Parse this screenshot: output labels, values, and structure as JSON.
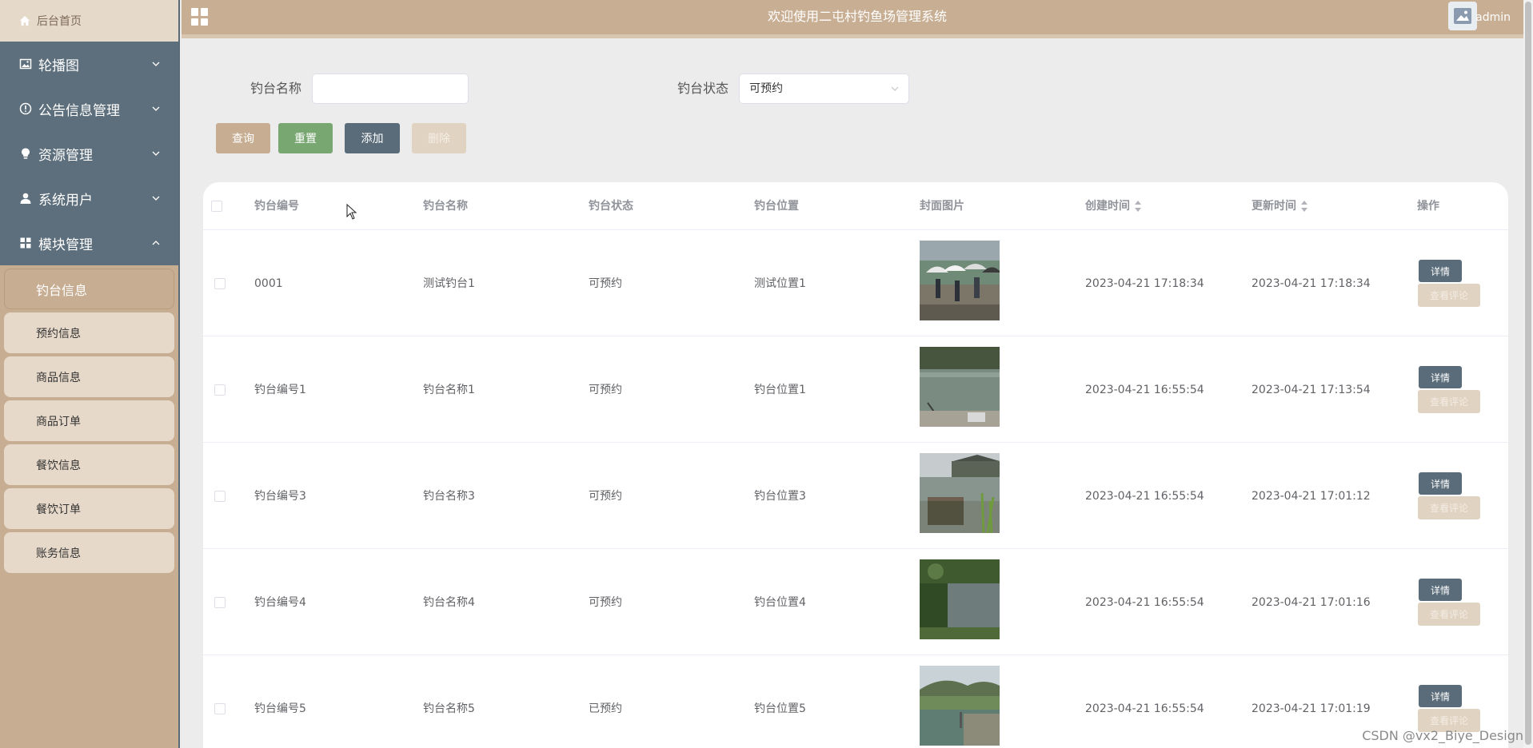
{
  "sidebar": {
    "home_label": "后台首页",
    "menus": [
      {
        "label": "轮播图",
        "icon": "picture-icon"
      },
      {
        "label": "公告信息管理",
        "icon": "info-circle-icon"
      },
      {
        "label": "资源管理",
        "icon": "lightbulb-icon"
      },
      {
        "label": "系统用户",
        "icon": "user-icon"
      },
      {
        "label": "模块管理",
        "icon": "grid-icon"
      }
    ],
    "submenu": [
      "钓台信息",
      "预约信息",
      "商品信息",
      "商品订单",
      "餐饮信息",
      "餐饮订单",
      "账务信息"
    ]
  },
  "header": {
    "title": "欢迎使用二屯村钓鱼场管理系统",
    "user": "admin"
  },
  "search": {
    "name_label": "钓台名称",
    "name_value": "",
    "status_label": "钓台状态",
    "status_value": "可预约"
  },
  "buttons": {
    "query": "查询",
    "reset": "重置",
    "add": "添加",
    "delete": "删除"
  },
  "table": {
    "headers": [
      "钓台编号",
      "钓台名称",
      "钓台状态",
      "钓台位置",
      "封面图片",
      "创建时间",
      "更新时间",
      "操作"
    ],
    "detail_label": "详情",
    "review_label": "查看评论",
    "rows": [
      {
        "code": "0001",
        "name": "测试钓台1",
        "status": "可预约",
        "location": "测试位置1",
        "created": "2023-04-21 17:18:34",
        "updated": "2023-04-21 17:18:34"
      },
      {
        "code": "钓台编号1",
        "name": "钓台名称1",
        "status": "可预约",
        "location": "钓台位置1",
        "created": "2023-04-21 16:55:54",
        "updated": "2023-04-21 17:13:54"
      },
      {
        "code": "钓台编号3",
        "name": "钓台名称3",
        "status": "可预约",
        "location": "钓台位置3",
        "created": "2023-04-21 16:55:54",
        "updated": "2023-04-21 17:01:12"
      },
      {
        "code": "钓台编号4",
        "name": "钓台名称4",
        "status": "可预约",
        "location": "钓台位置4",
        "created": "2023-04-21 16:55:54",
        "updated": "2023-04-21 17:01:16"
      },
      {
        "code": "钓台编号5",
        "name": "钓台名称5",
        "status": "已预约",
        "location": "钓台位置5",
        "created": "2023-04-21 16:55:54",
        "updated": "2023-04-21 17:01:19"
      }
    ]
  },
  "watermark": "CSDN @vx2_Biye_Design",
  "colors": {
    "sidebar_tan": "#c7ad92",
    "menu_slate": "#5d6f7c",
    "submenu_bg": "#e6d9c9",
    "query_btn": "#c7ad92",
    "reset_btn": "#78a772",
    "add_btn": "#5a6c79",
    "delete_btn": "#e1d3c2"
  }
}
